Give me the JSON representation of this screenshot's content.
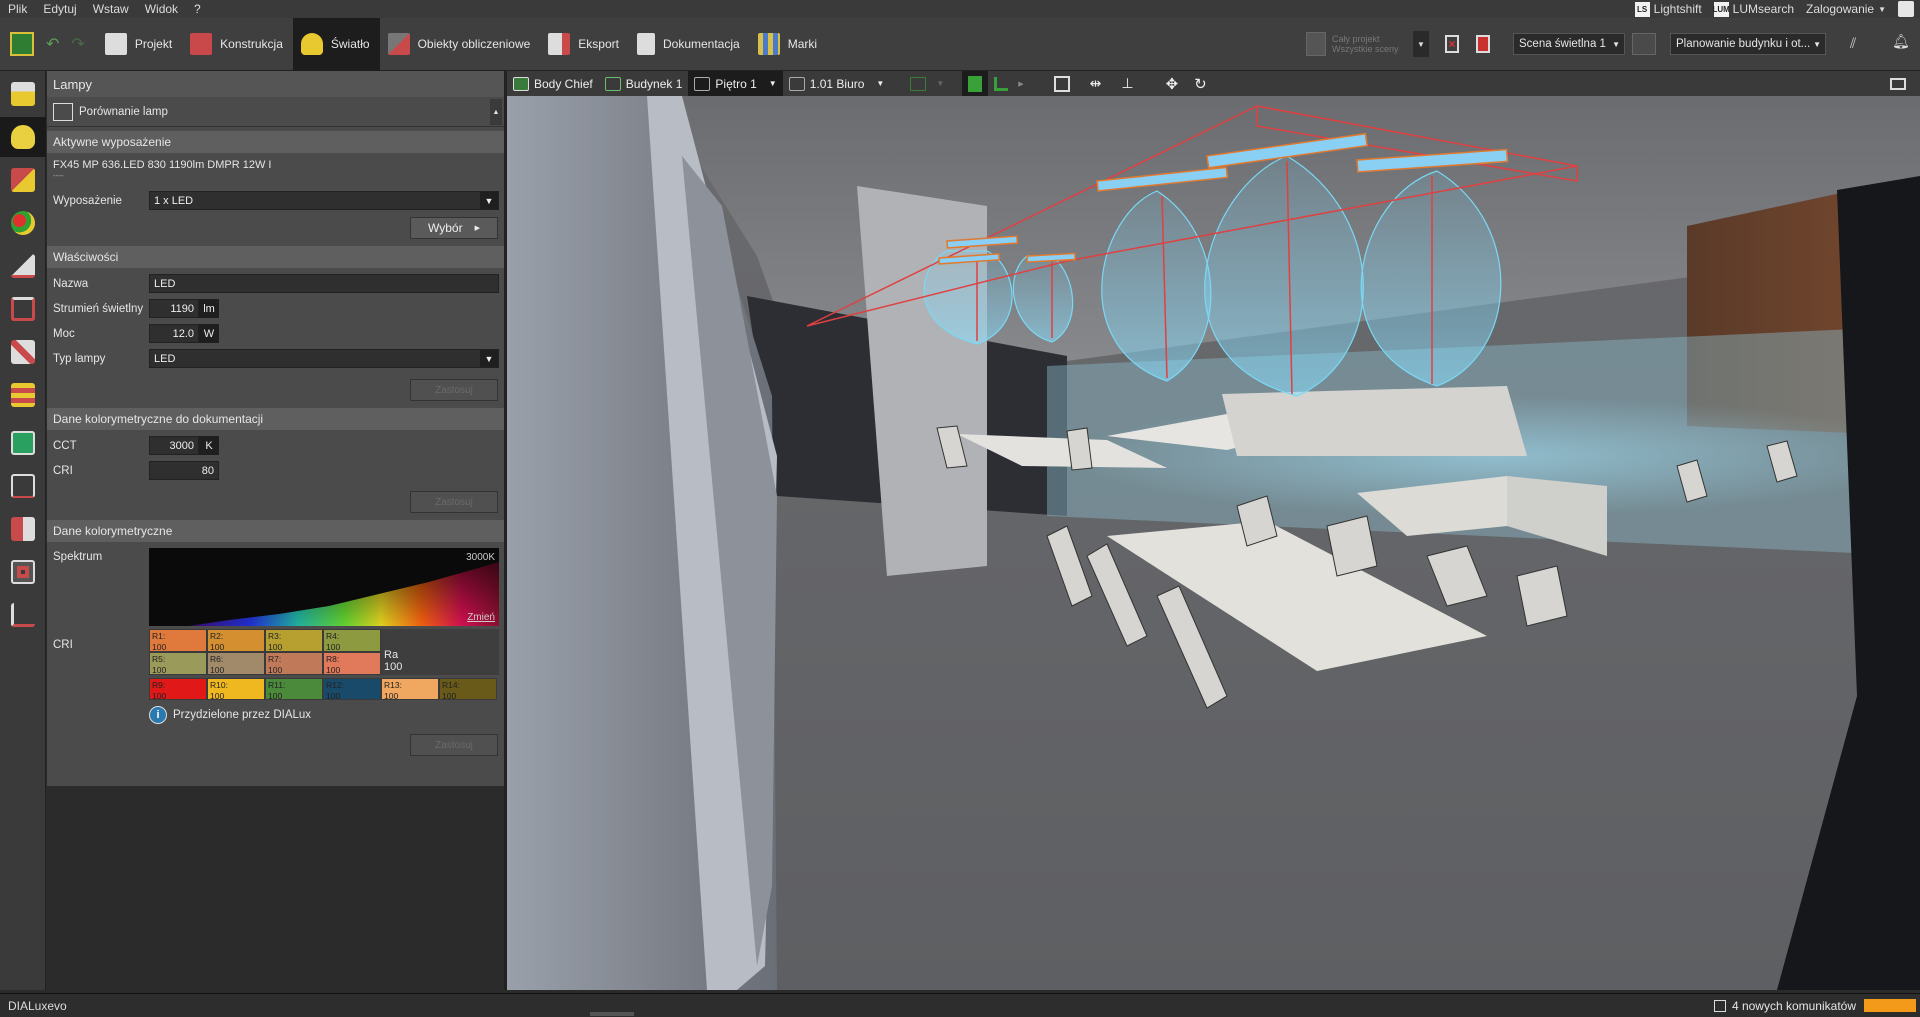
{
  "menu": {
    "items": [
      "Plik",
      "Edytuj",
      "Wstaw",
      "Widok",
      "?"
    ],
    "right": {
      "lightshift": "Lightshift",
      "lumsearch": "LUMsearch",
      "login": "Zalogowanie"
    }
  },
  "toolbar": {
    "tabs": [
      {
        "label": "Projekt",
        "color": "#cfcfcf"
      },
      {
        "label": "Konstrukcja",
        "color": "#c9494a"
      },
      {
        "label": "Światło",
        "color": "#e8c930"
      },
      {
        "label": "Obiekty obliczeniowe",
        "color": "#c94a4a"
      },
      {
        "label": "Eksport",
        "color": "#c94a4a"
      },
      {
        "label": "Dokumentacja",
        "color": "#cfcfcf"
      },
      {
        "label": "Marki",
        "color": "#d8c04a"
      }
    ],
    "project_line1": "Cały projekt",
    "project_line2": "Wszystkie sceny",
    "scene": "Scena świetlna 1",
    "planning": "Planowanie budynku i ot..."
  },
  "panel": {
    "title": "Lampy",
    "compare": "Porównanie lamp",
    "active_eq": {
      "header": "Aktywne wyposażenie",
      "name": "FX45 MP 636.LED 830 1190lm DMPR 12W I",
      "sub": "----",
      "eq_label": "Wyposażenie",
      "eq_value": "1 x LED",
      "select_btn": "Wybór"
    },
    "props": {
      "header": "Właściwości",
      "name_label": "Nazwa",
      "name_value": "LED",
      "flux_label": "Strumień świetlny",
      "flux_value": "1190",
      "flux_unit": "lm",
      "power_label": "Moc",
      "power_value": "12.0",
      "power_unit": "W",
      "type_label": "Typ lampy",
      "type_value": "LED",
      "apply": "Zastosuj"
    },
    "colordoc": {
      "header": "Dane kolorymetryczne do dokumentacji",
      "cct_label": "CCT",
      "cct_value": "3000",
      "cct_unit": "K",
      "cri_label": "CRI",
      "cri_value": "80",
      "apply": "Zastosuj"
    },
    "color": {
      "header": "Dane kolorymetryczne",
      "spectrum_label": "Spektrum",
      "spectrum_temp": "3000K",
      "change": "Zmień",
      "cri_label": "CRI",
      "cri_rows": [
        [
          {
            "k": "R1:",
            "v": "100",
            "c": "#e07a3c"
          },
          {
            "k": "R2:",
            "v": "100",
            "c": "#d49030"
          },
          {
            "k": "R3:",
            "v": "100",
            "c": "#b8a030"
          },
          {
            "k": "R4:",
            "v": "100",
            "c": "#8e9a40"
          }
        ],
        [
          {
            "k": "R5:",
            "v": "100",
            "c": "#9a9a5a"
          },
          {
            "k": "R6:",
            "v": "100",
            "c": "#a08a6a"
          },
          {
            "k": "R7:",
            "v": "100",
            "c": "#c07a5a"
          },
          {
            "k": "R8:",
            "v": "100",
            "c": "#e07a5a"
          }
        ]
      ],
      "cri_row2": [
        {
          "k": "R9:",
          "v": "100",
          "c": "#e01818"
        },
        {
          "k": "R10:",
          "v": "100",
          "c": "#f0b820"
        },
        {
          "k": "R11:",
          "v": "100",
          "c": "#4a8a3a"
        },
        {
          "k": "R12:",
          "v": "100",
          "c": "#1a4a6a"
        },
        {
          "k": "R13:",
          "v": "100",
          "c": "#f0a860"
        },
        {
          "k": "R14:",
          "v": "100",
          "c": "#6a5a1a"
        }
      ],
      "ra_label": "Ra",
      "ra_value": "100",
      "info": "Przydzielone przez DIALux",
      "apply": "Zastosuj"
    }
  },
  "view": {
    "items": [
      "Body Chief",
      "Budynek 1",
      "Piętro 1",
      "1.01 Biuro"
    ]
  },
  "status": {
    "brand": "DIALux",
    "brand2": "evo",
    "messages": "4 nowych komunikatów"
  }
}
